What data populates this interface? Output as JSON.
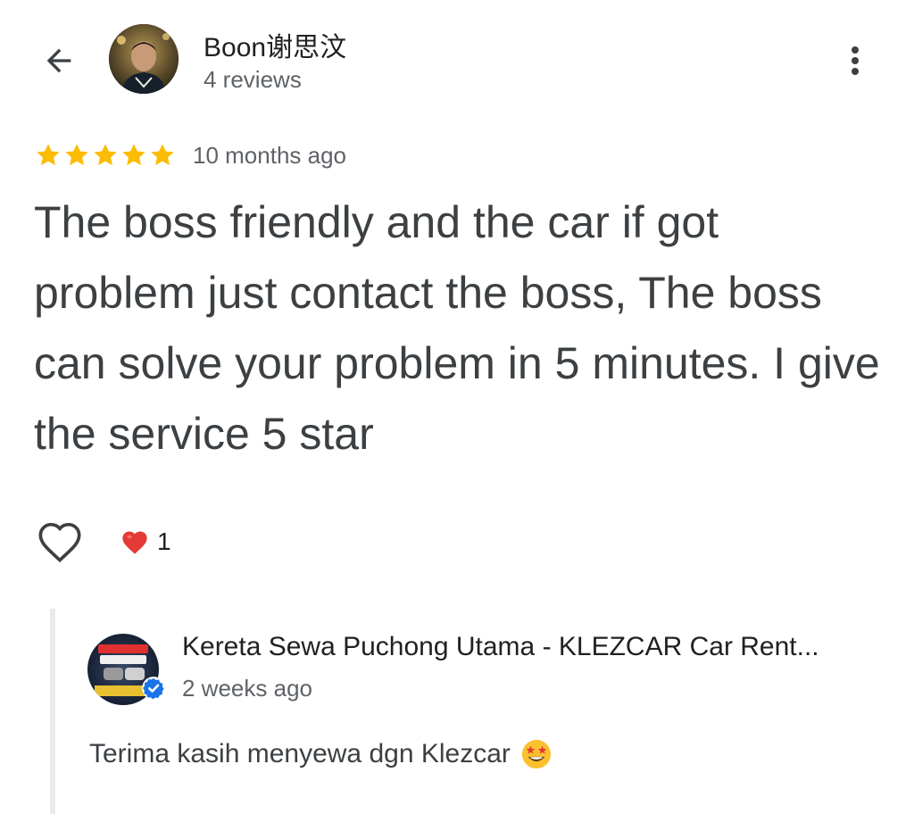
{
  "header": {
    "reviewer_name": "Boon谢思汶",
    "reviewer_meta": "4 reviews",
    "back_icon": "arrow-back-icon",
    "more_icon": "more-vert-icon"
  },
  "review": {
    "rating": 5,
    "max_rating": 5,
    "time": "10 months ago",
    "text": "The boss friendly and the car if got problem just contact the boss, The boss can solve your problem in 5 minutes. I give the service 5 star"
  },
  "reactions": {
    "like_icon": "heart-outline-icon",
    "summary_icon": "red-heart-icon",
    "count": "1"
  },
  "owner_reply": {
    "name": "Kereta Sewa Puchong Utama - KLEZCAR Car Rent...",
    "time": "2 weeks ago",
    "text": "Terima kasih menyewa dgn Klezcar",
    "emoji_icon": "star-struck-emoji-icon",
    "verified_icon": "verified-check-icon"
  },
  "colors": {
    "star": "#fbbc04",
    "verified": "#1a73e8",
    "heart": "#ea4335",
    "text": "#3c4043",
    "secondary": "#5f6368"
  }
}
